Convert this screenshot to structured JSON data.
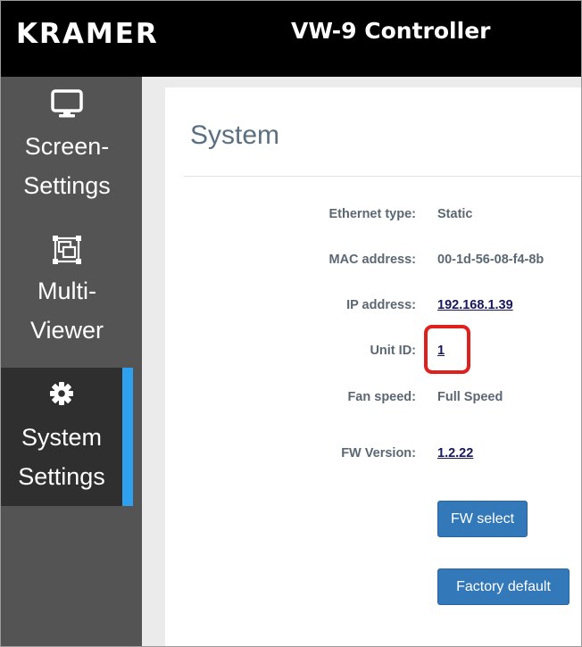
{
  "header": {
    "brand": "KRAMER",
    "title": "VW-9 Controller"
  },
  "sidebar": {
    "items": [
      {
        "icon": "monitor-icon",
        "line1": "Screen-",
        "line2": "Settings",
        "active": false
      },
      {
        "icon": "multiviewer-icon",
        "line1": "Multi-",
        "line2": "Viewer",
        "active": false
      },
      {
        "icon": "gear-icon",
        "line1": "System",
        "line2": "Settings",
        "active": true
      }
    ],
    "active_color": "#2fa0ee"
  },
  "panel": {
    "title": "System",
    "fields": {
      "ethernet_type": {
        "label": "Ethernet type:",
        "value": "Static"
      },
      "mac_address": {
        "label": "MAC address:",
        "value": "00-1d-56-08-f4-8b"
      },
      "ip_address": {
        "label": "IP address:",
        "value": "192.168.1.39"
      },
      "unit_id": {
        "label": "Unit ID:",
        "value": "1"
      },
      "fan_speed": {
        "label": "Fan speed:",
        "value": "Full Speed"
      },
      "fw_version": {
        "label": "FW Version:",
        "value": "1.2.22"
      }
    },
    "buttons": {
      "fw_select": "FW select",
      "factory_default": "Factory default"
    },
    "highlight_color": "#e0201c",
    "button_color": "#3378b8"
  }
}
